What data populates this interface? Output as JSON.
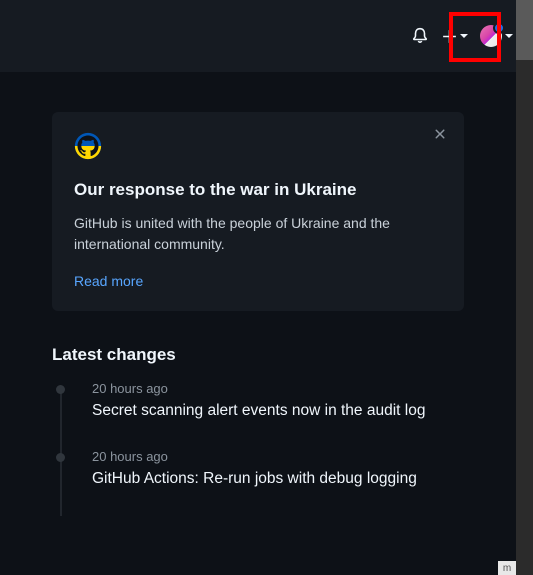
{
  "header": {
    "notifications_icon": "bell-icon",
    "create_icon": "plus-icon",
    "avatar_icon": "avatar"
  },
  "banner": {
    "icon": "github-ukraine-icon",
    "title": "Our response to the war in Ukraine",
    "body": "GitHub is united with the people of Ukraine and the international community.",
    "link_label": "Read more"
  },
  "changes": {
    "heading": "Latest changes",
    "items": [
      {
        "time": "20 hours ago",
        "title": "Secret scanning alert events now in the audit log"
      },
      {
        "time": "20 hours ago",
        "title": "GitHub Actions: Re-run jobs with debug logging"
      }
    ]
  },
  "corner_text": "m"
}
